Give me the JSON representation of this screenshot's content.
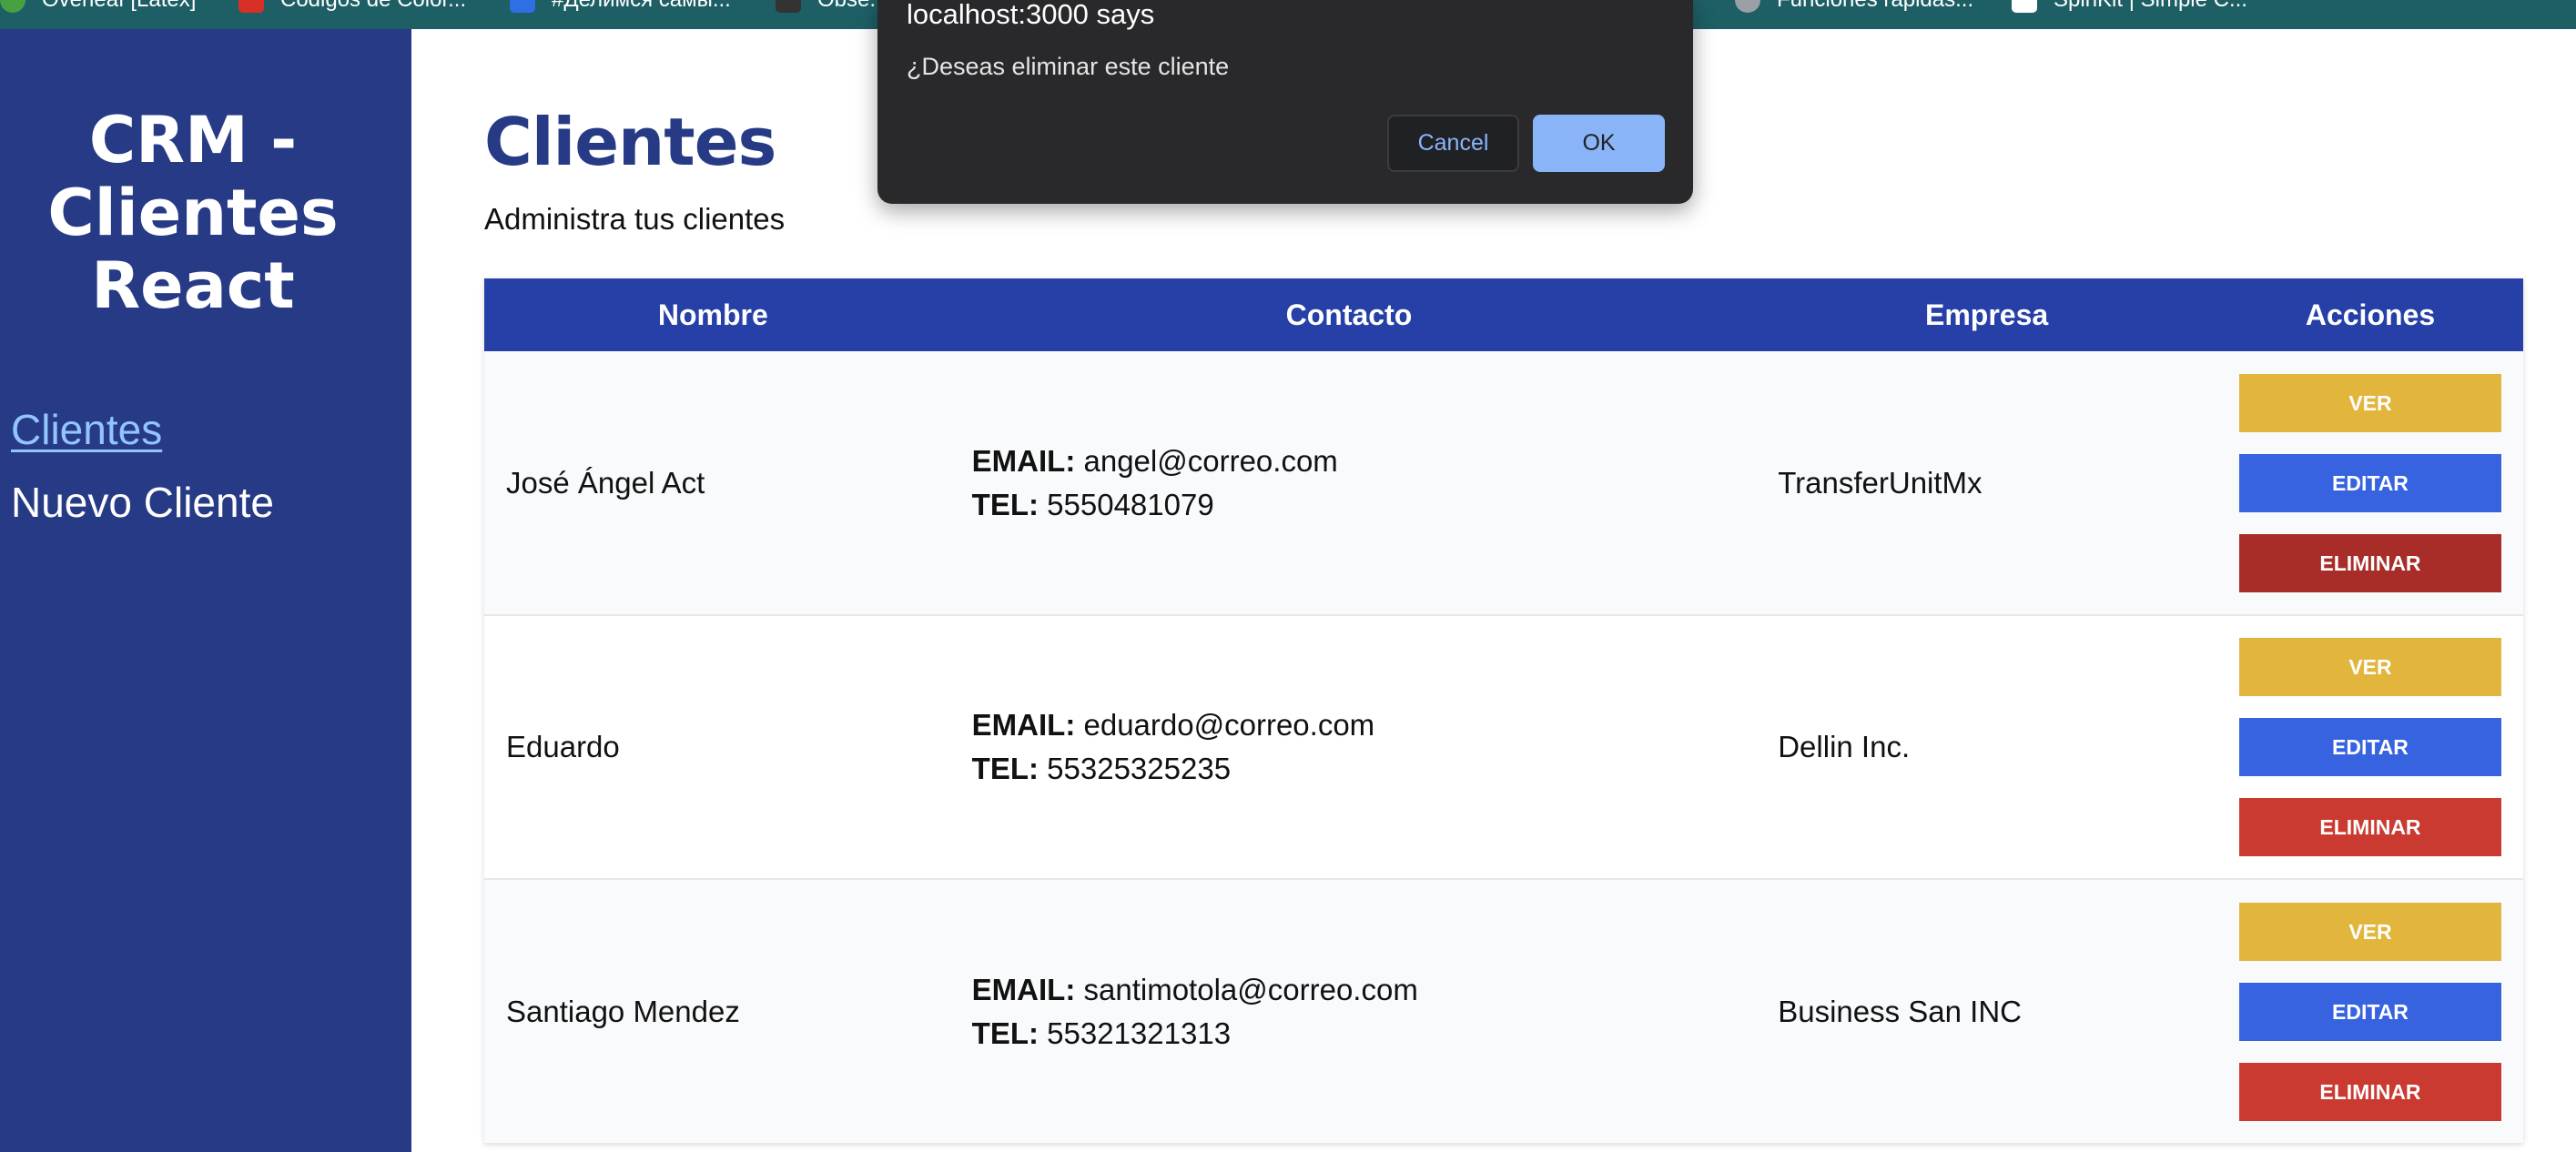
{
  "bookmarks": [
    {
      "label": "Overleaf [Latex]",
      "color": "#47a141"
    },
    {
      "label": "Códigos de Color...",
      "color": "#d93025"
    },
    {
      "label": "#Делимся самы...",
      "color": "#2f6fe4"
    },
    {
      "label": "Obse...",
      "color": "#333333"
    },
    {
      "label": "Funciones rápidas...",
      "color": "#9aa0a6"
    },
    {
      "label": "SpinKit | Simple C...",
      "color": "#ffffff"
    }
  ],
  "sidebar": {
    "brand": "CRM - Clientes React",
    "nav": [
      {
        "label": "Clientes",
        "active": true
      },
      {
        "label": "Nuevo Cliente",
        "active": false
      }
    ]
  },
  "main": {
    "title": "Clientes",
    "subtitle": "Administra tus clientes"
  },
  "table": {
    "headers": [
      "Nombre",
      "Contacto",
      "Empresa",
      "Acciones"
    ],
    "email_label": "EMAIL:",
    "tel_label": "TEL:",
    "rows": [
      {
        "nombre": "José Ángel Act",
        "email": "angel@correo.com",
        "tel": "5550481079",
        "empresa": "TransferUnitMx"
      },
      {
        "nombre": "Eduardo",
        "email": "eduardo@correo.com",
        "tel": "55325325235",
        "empresa": "Dellin Inc."
      },
      {
        "nombre": "Santiago Mendez",
        "email": "santimotola@correo.com",
        "tel": "55321321313",
        "empresa": "Business San INC"
      }
    ],
    "actions": {
      "ver": "Ver",
      "editar": "Editar",
      "eliminar": "Eliminar"
    }
  },
  "dialog": {
    "title": "localhost:3000 says",
    "message": "¿Deseas eliminar este cliente",
    "cancel": "Cancel",
    "ok": "OK"
  },
  "colors": {
    "sidebar": "#263a86",
    "header": "#2640a8",
    "ver": "#e2b53d",
    "editar": "#3763e0",
    "eliminar": "#cb3a31"
  }
}
